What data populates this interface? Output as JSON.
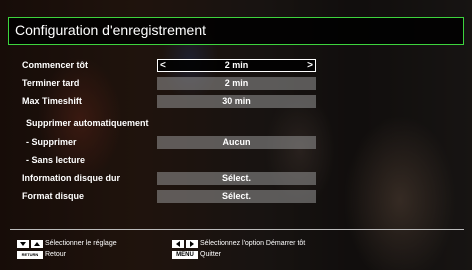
{
  "title": "Configuration d'enregistrement",
  "rows": [
    {
      "label": "Commencer tôt",
      "value": "2 min"
    },
    {
      "label": "Terminer tard",
      "value": "2 min"
    },
    {
      "label": "Max Timeshift",
      "value": "30 min"
    },
    {
      "label": "Supprimer automatiquement",
      "value": ""
    },
    {
      "label": "- Supprimer",
      "value": "Aucun"
    },
    {
      "label": "- Sans lecture",
      "value": ""
    },
    {
      "label": "Information disque dur",
      "value": "Sélect."
    },
    {
      "label": "Format disque",
      "value": "Sélect."
    }
  ],
  "footer": {
    "select_setting": "Sélectionner le réglage",
    "return_key": "RETURN",
    "return_label": "Retour",
    "select_option": "Sélectionnez l'option Démarrer tôt",
    "menu_key": "MENU",
    "menu_label": "Quitter"
  },
  "colors": {
    "accent_border": "#3dd43d",
    "selected_bg": "#000000",
    "value_bg": "#969696"
  },
  "icons": [
    "arrow-left-icon",
    "arrow-right-icon",
    "up-down-keys-icon",
    "left-right-keys-icon"
  ]
}
